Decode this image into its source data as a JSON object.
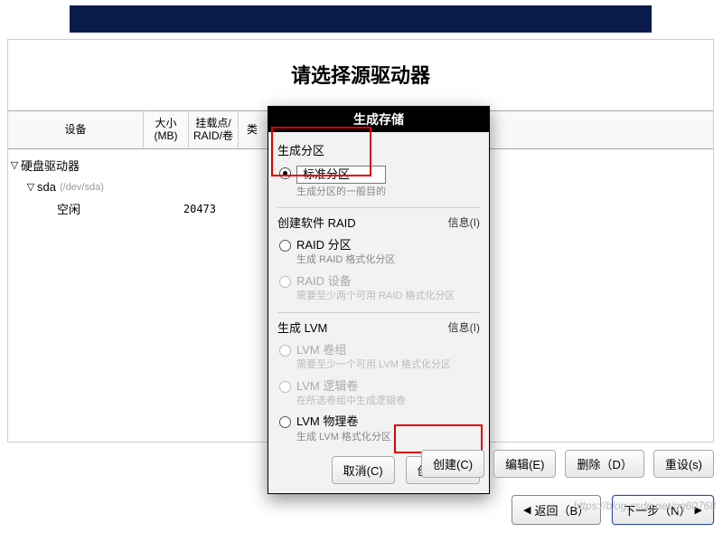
{
  "header": {
    "title": "请选择源驱动器"
  },
  "table": {
    "cols": {
      "device": "设备",
      "size_l1": "大小",
      "size_l2": "(MB)",
      "mount_l1": "挂载点/",
      "mount_l2": "RAID/卷",
      "type": "类"
    }
  },
  "tree": {
    "root": "硬盘驱动器",
    "disk": {
      "name": "sda",
      "path": "(/dev/sda)"
    },
    "free": {
      "label": "空闲",
      "size": "20473"
    }
  },
  "dialog": {
    "title": "生成存储",
    "sections": {
      "partition": {
        "title": "生成分区"
      },
      "raid": {
        "title": "创建软件 RAID",
        "info": "信息(I)"
      },
      "lvm": {
        "title": "生成 LVM",
        "info": "信息(I)"
      }
    },
    "options": {
      "standard": {
        "label": "标准分区",
        "desc": "生成分区的一般目的"
      },
      "raid_part": {
        "label": "RAID 分区",
        "desc": "生成 RAID 格式化分区"
      },
      "raid_dev": {
        "label": "RAID 设备",
        "desc": "需要至少两个可用 RAID 格式化分区"
      },
      "lvm_vg": {
        "label": "LVM 卷组",
        "desc": "需要至少一个可用 LVM 格式化分区"
      },
      "lvm_lv": {
        "label": "LVM 逻辑卷",
        "desc": "在所选卷组中生成逻辑卷"
      },
      "lvm_pv": {
        "label": "LVM 物理卷",
        "desc": "生成 LVM 格式化分区"
      }
    },
    "buttons": {
      "cancel": "取消(C)",
      "create": "创建（r）"
    }
  },
  "bottomButtons": {
    "create": "创建(C)",
    "edit": "编辑(E)",
    "delete": "删除（D）",
    "reset": "重设(s)"
  },
  "nav": {
    "back": "返回（B）",
    "next": "下一步（N）"
  },
  "watermark": "https://blog.csdn.net/qq60768"
}
